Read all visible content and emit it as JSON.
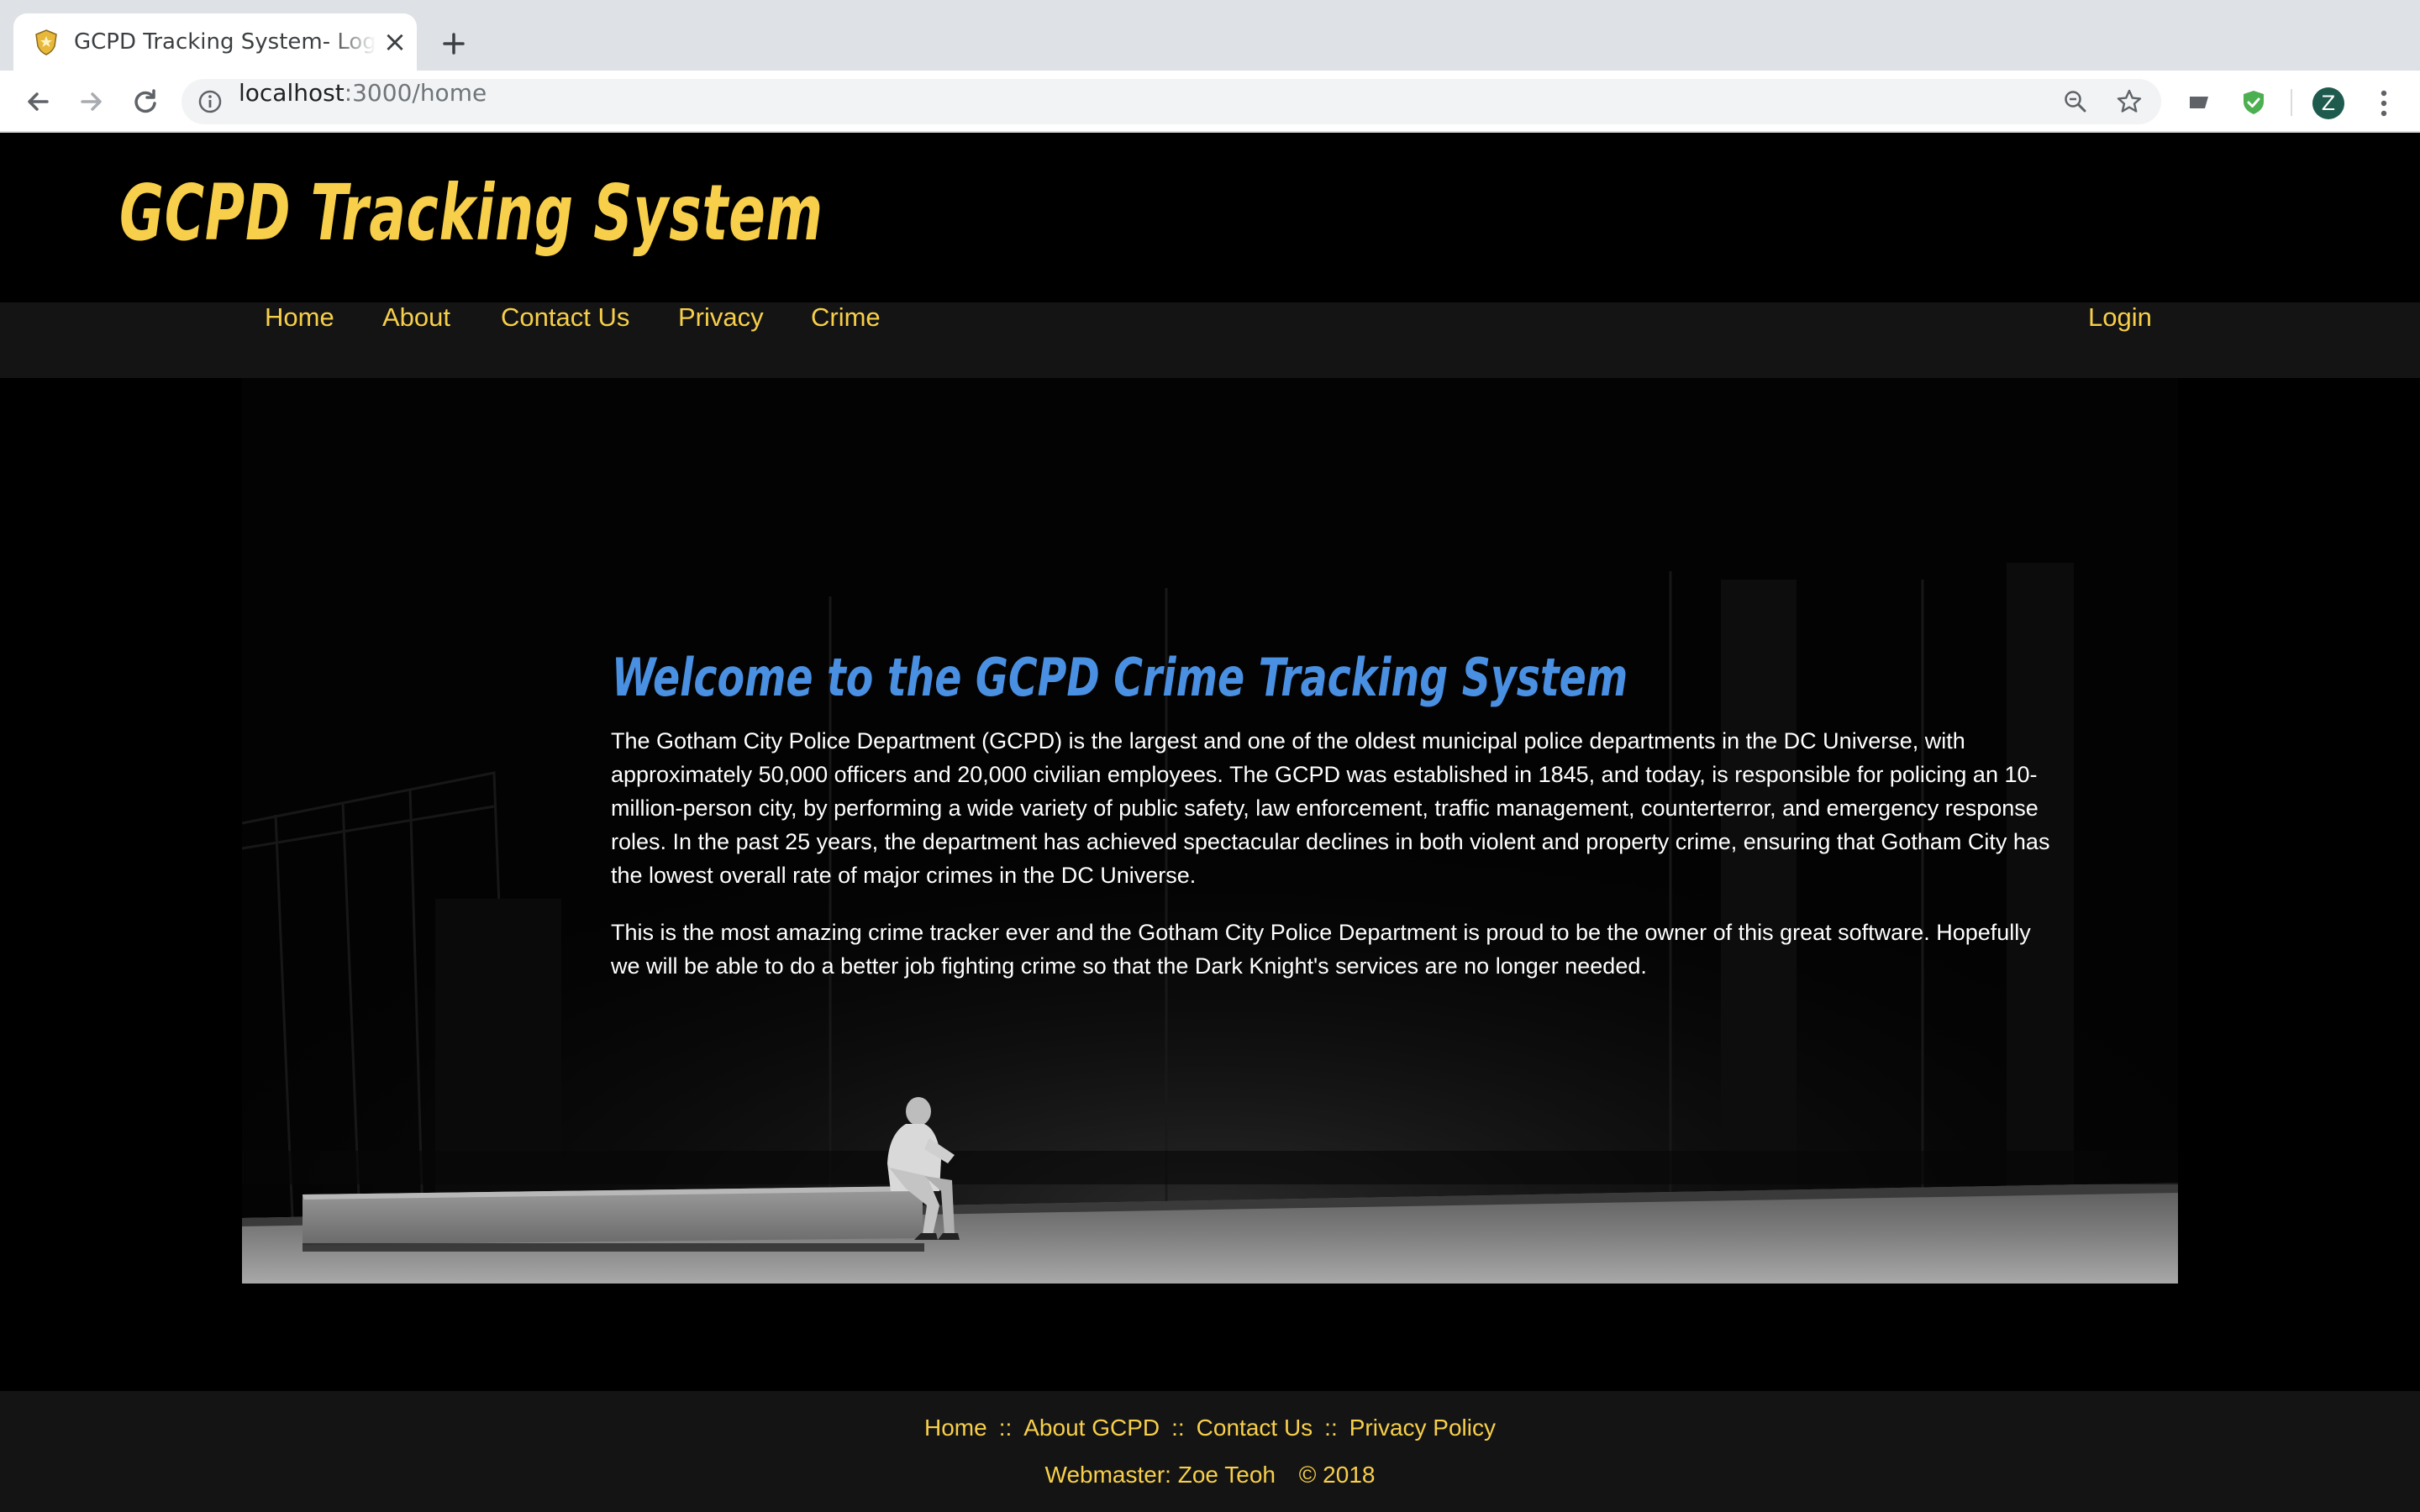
{
  "browser": {
    "tab_title": "GCPD Tracking System- Logged In",
    "url_host": "localhost",
    "url_path": ":3000/home",
    "profile_initial": "Z"
  },
  "site": {
    "title": "GCPD Tracking System"
  },
  "nav": {
    "items": [
      {
        "label": "Home"
      },
      {
        "label": "About"
      },
      {
        "label": "Contact Us"
      },
      {
        "label": "Privacy"
      },
      {
        "label": "Crime"
      }
    ],
    "login": "Login"
  },
  "main": {
    "heading": "Welcome to the GCPD Crime Tracking System",
    "paragraph1": "The Gotham City Police Department (GCPD) is the largest and one of the oldest municipal police departments in the DC Universe, with approximately 50,000 officers and 20,000 civilian employees. The GCPD was established in 1845, and today, is responsible for policing an 10-million-person city, by performing a wide variety of public safety, law enforcement, traffic management, counterterror, and emergency response roles. In the past 25 years, the department has achieved spectacular declines in both violent and property crime, ensuring that Gotham City has the lowest overall rate of major crimes in the DC Universe.",
    "paragraph2": "This is the most amazing crime tracker ever and the Gotham City Police Department is proud to be the owner of this great software. Hopefully we will be able to do a better job fighting crime so that the Dark Knight's services are no longer needed."
  },
  "footer": {
    "links": [
      {
        "label": "Home"
      },
      {
        "label": "About GCPD"
      },
      {
        "label": "Contact Us"
      },
      {
        "label": "Privacy Policy"
      }
    ],
    "separator": "::",
    "webmaster_label": "Webmaster:",
    "webmaster_name": "Zoe Teoh",
    "copyright": "© 2018"
  },
  "colors": {
    "brand_yellow": "#f7cf4a",
    "heading_blue": "#4a90e2",
    "navbar_bg": "#141414"
  }
}
